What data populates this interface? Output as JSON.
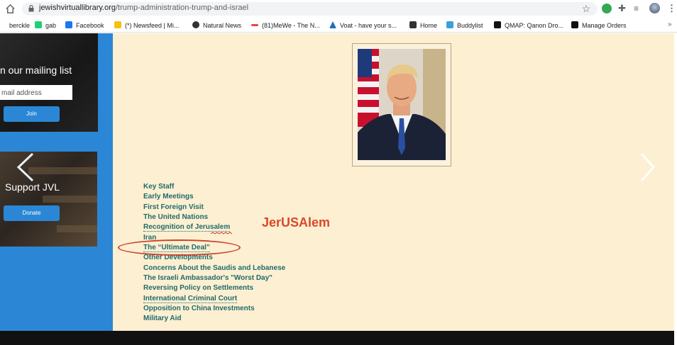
{
  "browser": {
    "url_host": "jewishvirtuallibrary.org",
    "url_path": "/trump-administration-trump-and-israel",
    "bookmarks": [
      {
        "label": "berckle",
        "icon": "music-icon",
        "color": "#ffffff"
      },
      {
        "label": "gab",
        "icon": "gab-icon",
        "color": "#21cf7a"
      },
      {
        "label": "Facebook",
        "icon": "facebook-icon",
        "color": "#1877f2"
      },
      {
        "label": "(*) Newsfeed | Mi...",
        "icon": "bulb-icon",
        "color": "#f4c20d"
      },
      {
        "label": "Natural News",
        "icon": "natural-news-icon",
        "color": "#333333"
      },
      {
        "label": "(81)MeWe - The N...",
        "icon": "mewe-icon",
        "color": "#e8453c"
      },
      {
        "label": "Voat - have your s...",
        "icon": "voat-icon",
        "color": "#1f6fbf"
      },
      {
        "label": "Home",
        "icon": "home-logo-icon",
        "color": "#333333"
      },
      {
        "label": "Buddylist",
        "icon": "buddylist-icon",
        "color": "#3aa0d8"
      },
      {
        "label": "QMAP: Qanon Dro...",
        "icon": "qmap-icon",
        "color": "#111111"
      },
      {
        "label": "Manage Orders",
        "icon": "amazon-icon",
        "color": "#111111"
      }
    ],
    "more_label": "»"
  },
  "sidebar": {
    "mailing_title": "n our mailing list",
    "email_placeholder": "mail address",
    "join_label": "Join",
    "support_title": "Support JVL",
    "donate_label": "Donate"
  },
  "toc": [
    "Key Staff",
    "Early Meetings",
    "First Foreign Visit",
    "The United Nations",
    "Recognition of Jerusalem",
    "Iran",
    "The “Ultimate Deal”",
    "Other Developments",
    "Concerns About the Saudis and Lebanese",
    "The Israeli Ambassador's \"Worst Day\"",
    "Reversing Policy on Settlements",
    "International Criminal Court",
    "Opposition to China Investments",
    "Military Aid"
  ],
  "annotation": {
    "text": "JerUSAlem",
    "color": "#d9482b",
    "circled_item": "The “Ultimate Deal”"
  },
  "colors": {
    "sidebar_blue": "#2b87d5",
    "content_bg": "#fdefd1",
    "link_teal": "#1f6b6b"
  }
}
